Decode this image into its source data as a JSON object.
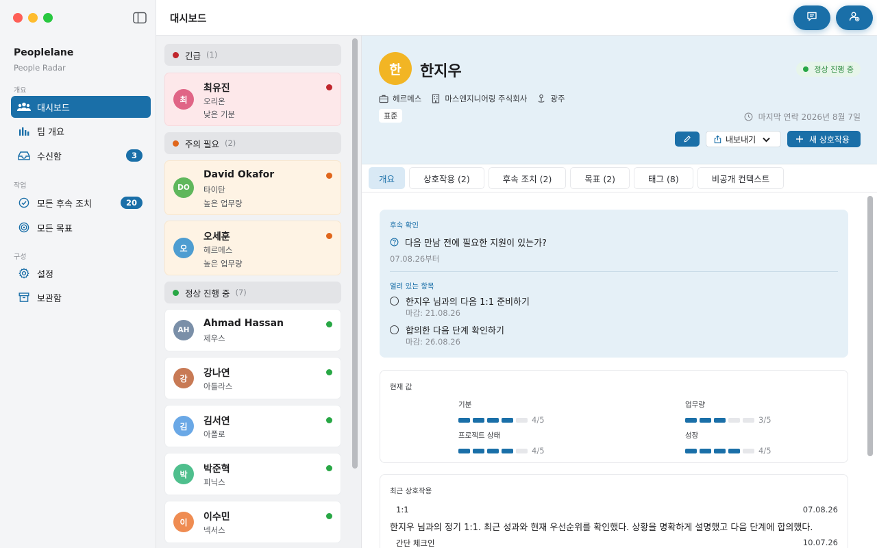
{
  "sidebar": {
    "app_title": "Peoplelane",
    "app_subtitle": "People Radar",
    "sections": [
      "개요",
      "작업",
      "구성"
    ],
    "items": [
      {
        "label": "대시보드",
        "icon": "people-icon",
        "active": true
      },
      {
        "label": "팀 개요",
        "icon": "bar-chart-icon"
      },
      {
        "label": "수신함",
        "icon": "inbox-icon",
        "badge": "3"
      },
      {
        "label": "모든 후속 조치",
        "icon": "check-circle-icon",
        "badge": "20"
      },
      {
        "label": "모든 목표",
        "icon": "target-icon"
      },
      {
        "label": "설정",
        "icon": "gear-icon"
      },
      {
        "label": "보관함",
        "icon": "archive-icon"
      }
    ]
  },
  "topbar": {
    "title": "대시보드"
  },
  "list": {
    "groups": [
      {
        "label": "긴급",
        "count": "(1)",
        "color": "#c0262d"
      },
      {
        "label": "주의 필요",
        "count": "(2)",
        "color": "#e0661b"
      },
      {
        "label": "정상 진행 중",
        "count": "(7)",
        "color": "#28a745"
      }
    ],
    "people": [
      {
        "initials": "최",
        "name": "최유진",
        "line1": "오리온",
        "line2": "낮은 기분",
        "avatar_color": "#e06586",
        "dot": "#c0262d"
      },
      {
        "initials": "DO",
        "name": "David Okafor",
        "line1": "타이탄",
        "line2": "높은 업무량",
        "avatar_color": "#5fb75c",
        "dot": "#e0661b"
      },
      {
        "initials": "오",
        "name": "오세훈",
        "line1": "헤르메스",
        "line2": "높은 업무량",
        "avatar_color": "#4e9dd1",
        "dot": "#e0661b"
      },
      {
        "initials": "AH",
        "name": "Ahmad Hassan",
        "line1": "제우스",
        "avatar_color": "#7a8fa8",
        "dot": "#28a745"
      },
      {
        "initials": "강",
        "name": "강나연",
        "line1": "아틀라스",
        "avatar_color": "#c87a55",
        "dot": "#28a745"
      },
      {
        "initials": "김",
        "name": "김서연",
        "line1": "아폴로",
        "avatar_color": "#6aa8e6",
        "dot": "#28a745"
      },
      {
        "initials": "박",
        "name": "박준혁",
        "line1": "피닉스",
        "avatar_color": "#4fbf8d",
        "dot": "#28a745"
      },
      {
        "initials": "이",
        "name": "이수민",
        "line1": "넥서스",
        "avatar_color": "#ef8c52",
        "dot": "#28a745"
      }
    ]
  },
  "detail": {
    "initials": "한",
    "name": "한지우",
    "status": "정상 진행 중",
    "team": "헤르메스",
    "company": "마스엔지니어링 주식회사",
    "location": "광주",
    "chip": "표준",
    "last_contact": "마지막 연락 2026년 8월 7일",
    "export_label": "내보내기",
    "new_label": "새 상호작용",
    "tabs": [
      "개요",
      "상호작용 (2)",
      "후속 조치 (2)",
      "목표 (2)",
      "태그 (8)",
      "비공개 컨텍스트"
    ],
    "followup": {
      "label": "후속 확인",
      "question": "다음 만남 전에 필요한 지원이 있는가?",
      "since": "07.08.26부터",
      "open_label": "열려 있는 항목",
      "items": [
        {
          "title": "한지우 님과의 다음 1:1 준비하기",
          "due": "마감: 21.08.26"
        },
        {
          "title": "합의한 다음 단계 확인하기",
          "due": "마감: 26.08.26"
        }
      ]
    },
    "values": {
      "title": "현재 값",
      "metrics": [
        {
          "label": "기분",
          "value": 4,
          "max": 5,
          "text": "4/5"
        },
        {
          "label": "업무량",
          "value": 3,
          "max": 5,
          "text": "3/5"
        },
        {
          "label": "프로젝트 상태",
          "value": 4,
          "max": 5,
          "text": "4/5"
        },
        {
          "label": "성장",
          "value": 4,
          "max": 5,
          "text": "4/5"
        }
      ]
    },
    "recent": {
      "title": "최근 상호작용",
      "items": [
        {
          "type": "1:1",
          "date": "07.08.26",
          "text": "한지우 님과의 정기 1:1. 최근 성과와 현재 우선순위를 확인했다. 상황을 명확하게 설명했고 다음 단계에 합의했다."
        },
        {
          "type": "간단 체크인",
          "date": "10.07.26"
        }
      ]
    }
  },
  "colors": {
    "accent": "#1a6fa8"
  }
}
